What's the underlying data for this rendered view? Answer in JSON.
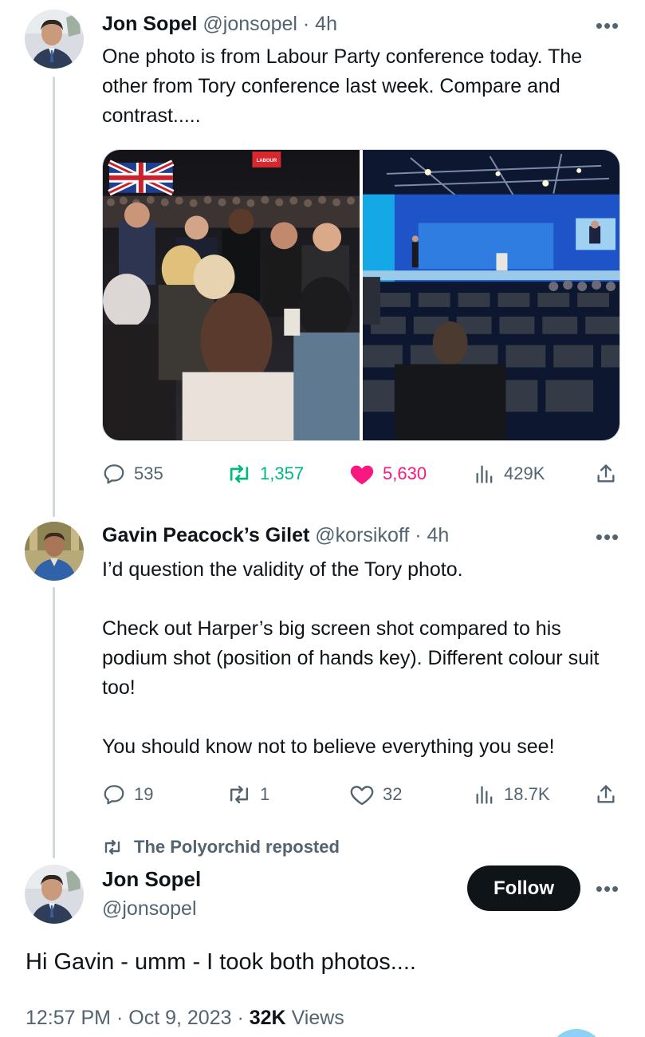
{
  "tweet1": {
    "name": "Jon Sopel",
    "handle": "@jonsopel",
    "separator": "·",
    "time": "4h",
    "text": "One photo is from Labour Party conference today. The other from Tory conference last week. Compare and contrast.....",
    "banner_text": "LABOUR",
    "stats": {
      "replies": "535",
      "reposts": "1,357",
      "likes": "5,630",
      "views": "429K"
    }
  },
  "tweet2": {
    "name": "Gavin Peacock’s Gilet",
    "handle": "@korsikoff",
    "separator": "·",
    "time": "4h",
    "paragraphs": [
      "I’d question the validity of the Tory photo.",
      "Check out Harper’s big screen shot compared to his podium shot (position of hands key). Different colour suit too!",
      "You should know not to believe everything you see!"
    ],
    "stats": {
      "replies": "19",
      "reposts": "1",
      "likes": "32",
      "views": "18.7K"
    }
  },
  "main": {
    "reposted_by": "The Polyorchid reposted",
    "name": "Jon Sopel",
    "handle": "@jonsopel",
    "follow_label": "Follow",
    "text": "Hi Gavin - umm - I took both photos....",
    "time": "12:57 PM",
    "sep1": "·",
    "date": "Oct 9, 2023",
    "sep2": "·",
    "views_count": "32K",
    "views_label": "Views"
  },
  "icons": {
    "reply": "speech-bubble-icon",
    "repost": "repost-arrows-icon",
    "like": "heart-icon",
    "views": "bar-chart-icon",
    "share": "share-upload-icon",
    "more": "ellipsis-icon"
  },
  "colors": {
    "text": "#0f1419",
    "muted": "#536471",
    "repost_active": "#00ba7c",
    "like_active": "#f91880",
    "thread_line": "#cfd9de",
    "follow_bg": "#0f1419"
  }
}
